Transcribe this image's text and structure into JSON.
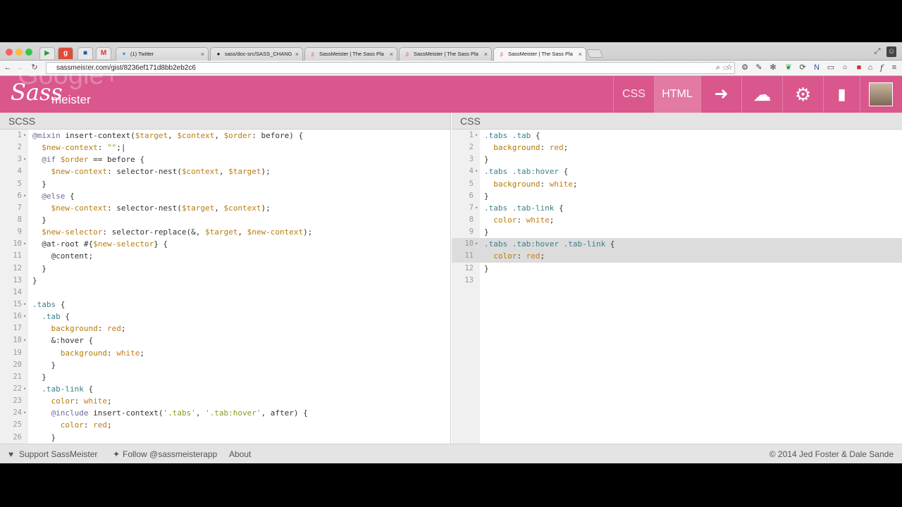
{
  "browser": {
    "tabs": [
      {
        "title": "(1) Twitter",
        "icon": "twitter-icon"
      },
      {
        "title": "sass/doc-src/SASS_CHANG",
        "icon": "github-icon"
      },
      {
        "title": "SassMeister | The Sass Pla",
        "icon": "sassmeister-icon"
      },
      {
        "title": "SassMeister | The Sass Pla",
        "icon": "sassmeister-icon"
      },
      {
        "title": "SassMeister | The Sass Pla",
        "icon": "sassmeister-icon"
      }
    ],
    "url": "sassmeister.com/gist/8236ef171d8bb2eb2c6",
    "overlay_text": "Google+"
  },
  "app": {
    "logo_script": "Sass",
    "logo_text": "meister",
    "nav": {
      "css": "CSS",
      "html": "HTML"
    },
    "accent": "#d9578c"
  },
  "scss": {
    "title": "SCSS",
    "lines": [
      [
        [
          "at",
          "@mixin"
        ],
        [
          "plain",
          " insert-context("
        ],
        [
          "var",
          "$target"
        ],
        [
          "plain",
          ", "
        ],
        [
          "var",
          "$context"
        ],
        [
          "plain",
          ", "
        ],
        [
          "var",
          "$order"
        ],
        [
          "plain",
          ": before) {"
        ]
      ],
      [
        [
          "var",
          "  $new-context"
        ],
        [
          "plain",
          ": "
        ],
        [
          "str",
          "\"\""
        ],
        [
          "plain",
          ";|"
        ]
      ],
      [
        [
          "at",
          "  @if"
        ],
        [
          "plain",
          " "
        ],
        [
          "var",
          "$order"
        ],
        [
          "plain",
          " == before {"
        ]
      ],
      [
        [
          "var",
          "    $new-context"
        ],
        [
          "plain",
          ": selector-nest("
        ],
        [
          "var",
          "$context"
        ],
        [
          "plain",
          ", "
        ],
        [
          "var",
          "$target"
        ],
        [
          "plain",
          ");"
        ]
      ],
      [
        [
          "plain",
          "  }"
        ]
      ],
      [
        [
          "at",
          "  @else"
        ],
        [
          "plain",
          " {"
        ]
      ],
      [
        [
          "var",
          "    $new-context"
        ],
        [
          "plain",
          ": selector-nest("
        ],
        [
          "var",
          "$target"
        ],
        [
          "plain",
          ", "
        ],
        [
          "var",
          "$context"
        ],
        [
          "plain",
          ");"
        ]
      ],
      [
        [
          "plain",
          "  }"
        ]
      ],
      [
        [
          "var",
          "  $new-selector"
        ],
        [
          "plain",
          ": selector-replace(&, "
        ],
        [
          "var",
          "$target"
        ],
        [
          "plain",
          ", "
        ],
        [
          "var",
          "$new-context"
        ],
        [
          "plain",
          ");"
        ]
      ],
      [
        [
          "plain",
          "  @at-root #{"
        ],
        [
          "var",
          "$new-selector"
        ],
        [
          "plain",
          "} {"
        ]
      ],
      [
        [
          "plain",
          "    @content;"
        ]
      ],
      [
        [
          "plain",
          "  }"
        ]
      ],
      [
        [
          "plain",
          "}"
        ]
      ],
      [
        [
          "plain",
          ""
        ]
      ],
      [
        [
          "sel",
          ".tabs"
        ],
        [
          "plain",
          " {"
        ]
      ],
      [
        [
          "sel",
          "  .tab"
        ],
        [
          "plain",
          " {"
        ]
      ],
      [
        [
          "prop",
          "    background"
        ],
        [
          "plain",
          ": "
        ],
        [
          "val",
          "red"
        ],
        [
          "plain",
          ";"
        ]
      ],
      [
        [
          "plain",
          "    &:hover {"
        ]
      ],
      [
        [
          "prop",
          "      background"
        ],
        [
          "plain",
          ": "
        ],
        [
          "val",
          "white"
        ],
        [
          "plain",
          ";"
        ]
      ],
      [
        [
          "plain",
          "    }"
        ]
      ],
      [
        [
          "plain",
          "  }"
        ]
      ],
      [
        [
          "sel",
          "  .tab-link"
        ],
        [
          "plain",
          " {"
        ]
      ],
      [
        [
          "prop",
          "    color"
        ],
        [
          "plain",
          ": "
        ],
        [
          "val",
          "white"
        ],
        [
          "plain",
          ";"
        ]
      ],
      [
        [
          "at",
          "    @include"
        ],
        [
          "plain",
          " insert-context("
        ],
        [
          "str",
          "'.tabs'"
        ],
        [
          "plain",
          ", "
        ],
        [
          "str",
          "'.tab:hover'"
        ],
        [
          "plain",
          ", after) {"
        ]
      ],
      [
        [
          "prop",
          "      color"
        ],
        [
          "plain",
          ": "
        ],
        [
          "val",
          "red"
        ],
        [
          "plain",
          ";"
        ]
      ],
      [
        [
          "plain",
          "    }"
        ]
      ]
    ],
    "folds": [
      1,
      3,
      6,
      10,
      15,
      16,
      18,
      22,
      24
    ]
  },
  "css": {
    "title": "CSS",
    "lines": [
      [
        [
          "sel",
          ".tabs .tab"
        ],
        [
          "plain",
          " {"
        ]
      ],
      [
        [
          "prop",
          "  background"
        ],
        [
          "plain",
          ": "
        ],
        [
          "val",
          "red"
        ],
        [
          "plain",
          ";"
        ]
      ],
      [
        [
          "plain",
          "}"
        ]
      ],
      [
        [
          "sel",
          ".tabs .tab:hover"
        ],
        [
          "plain",
          " {"
        ]
      ],
      [
        [
          "prop",
          "  background"
        ],
        [
          "plain",
          ": "
        ],
        [
          "val",
          "white"
        ],
        [
          "plain",
          ";"
        ]
      ],
      [
        [
          "plain",
          "}"
        ]
      ],
      [
        [
          "sel",
          ".tabs .tab-link"
        ],
        [
          "plain",
          " {"
        ]
      ],
      [
        [
          "prop",
          "  color"
        ],
        [
          "plain",
          ": "
        ],
        [
          "val",
          "white"
        ],
        [
          "plain",
          ";"
        ]
      ],
      [
        [
          "plain",
          "}"
        ]
      ],
      [
        [
          "sel",
          ".tabs .tab:hover .tab-link"
        ],
        [
          "plain",
          " {"
        ]
      ],
      [
        [
          "prop",
          "  color"
        ],
        [
          "plain",
          ": "
        ],
        [
          "val",
          "red"
        ],
        [
          "plain",
          ";"
        ]
      ],
      [
        [
          "plain",
          "}"
        ]
      ],
      [
        [
          "plain",
          ""
        ]
      ]
    ],
    "folds": [
      1,
      4,
      7,
      10
    ],
    "highlight": [
      10,
      11
    ]
  },
  "footer": {
    "support": "Support SassMeister",
    "follow": "Follow @sassmeisterapp",
    "about": "About",
    "copyright": "© 2014 Jed Foster & Dale Sande"
  }
}
